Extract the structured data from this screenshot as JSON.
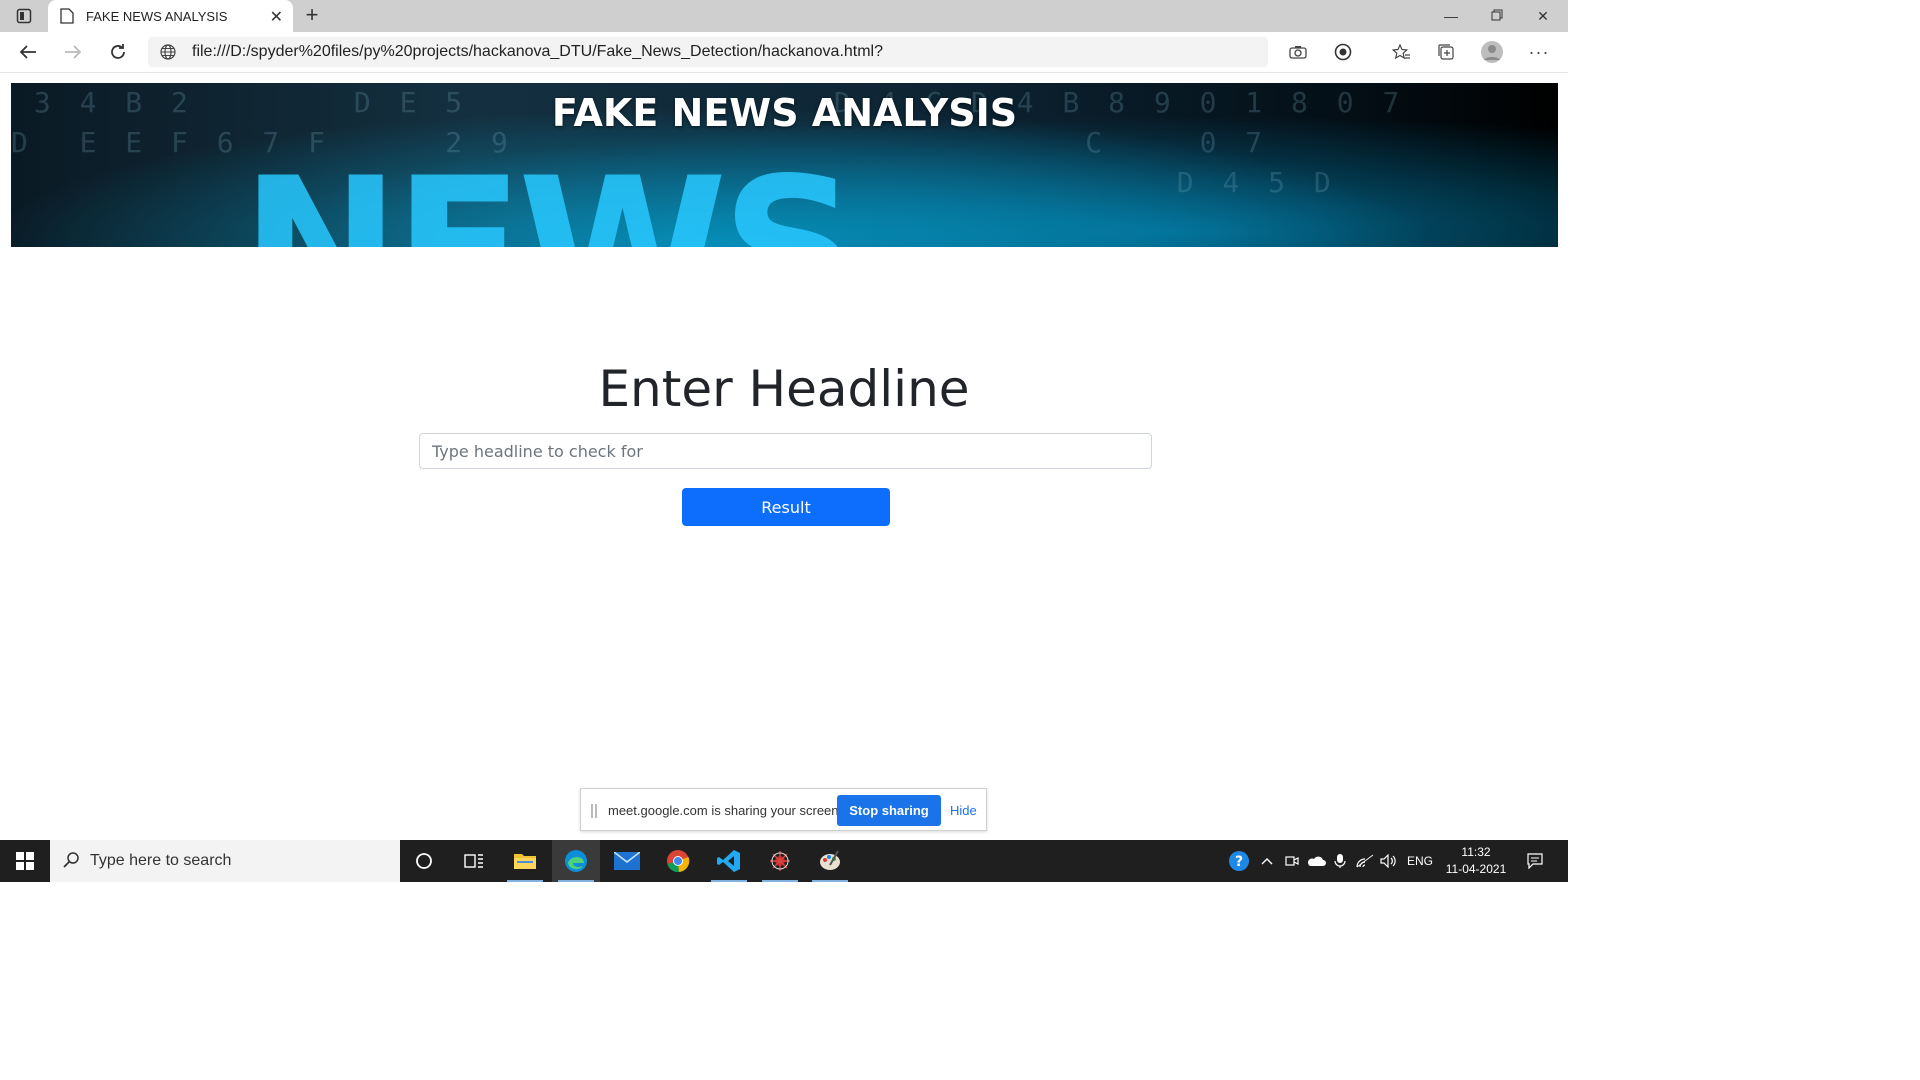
{
  "browser": {
    "tab_title": "FAKE NEWS ANALYSIS",
    "url": "file:///D:/spyder%20files/py%20projects/hackanova_DTU/Fake_News_Detection/hackanova.html?"
  },
  "page": {
    "banner_title": "FAKE NEWS ANALYSIS",
    "banner_word": "NEWS",
    "heading": "Enter Headline",
    "input_placeholder": "Type headline to check for",
    "button_label": "Result"
  },
  "sharing_bar": {
    "message": "meet.google.com is sharing your screen.",
    "stop_label": "Stop sharing",
    "hide_label": "Hide"
  },
  "taskbar": {
    "search_placeholder": "Type here to search",
    "language": "ENG",
    "time": "11:32",
    "date": "11-04-2021"
  },
  "colors": {
    "primary_button": "#0d6efd",
    "share_button": "#1a73e8",
    "taskbar": "#1f1f1f"
  }
}
